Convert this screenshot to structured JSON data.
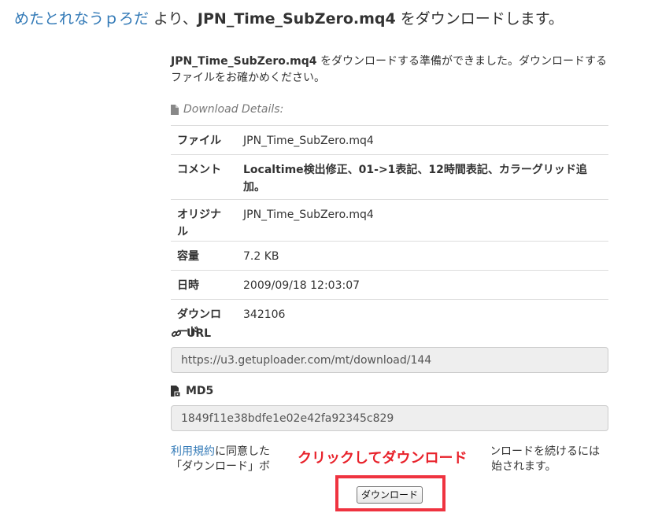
{
  "headline": {
    "uploader": "めたとれなうｐろだ",
    "part1": " より、",
    "filename": "JPN_Time_SubZero.mq4",
    "part2": " をダウンロードします。"
  },
  "intro": {
    "filename": "JPN_Time_SubZero.mq4",
    "text": " をダウンロードする準備ができました。ダウンロードするファイルをお確かめください。"
  },
  "details": {
    "title": "Download Details:",
    "rows": [
      {
        "label": "ファイル",
        "value": "JPN_Time_SubZero.mq4"
      },
      {
        "label": "コメント",
        "value": "Localtime検出修正、01->1表記、12時間表記、カラーグリッド追加。"
      },
      {
        "label": "オリジナル",
        "value": "JPN_Time_SubZero.mq4"
      },
      {
        "label": "容量",
        "value": "7.2 KB"
      },
      {
        "label": "日時",
        "value": "2009/09/18 12:03:07"
      },
      {
        "label": "ダウンロード",
        "value": "342106"
      }
    ]
  },
  "url": {
    "label": "URL",
    "value": "https://u3.getuploader.com/mt/download/144"
  },
  "md5": {
    "label": "MD5",
    "value": "1849f11e38bdfe1e02e42fa92345c829"
  },
  "terms": {
    "link": "利用規約",
    "line1_rest": "に同意した",
    "line2": "「ダウンロード」ボ",
    "line1_right": "ンロードを続けるには",
    "line2_right": "始されます。"
  },
  "callout": "クリックしてダウンロード",
  "download_button": "ダウンロード",
  "colors": {
    "link": "#337ab7",
    "callout": "#e8222b",
    "frame": "#ef3340"
  }
}
